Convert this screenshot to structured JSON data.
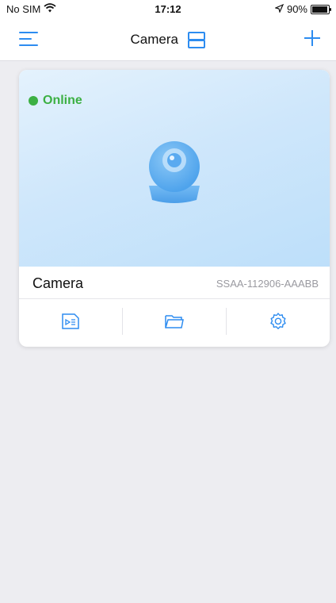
{
  "status_bar": {
    "carrier": "No SIM",
    "time": "17:12",
    "battery": "90%"
  },
  "nav": {
    "title": "Camera"
  },
  "device": {
    "status": "Online",
    "name": "Camera",
    "serial": "SSAA-112906-AAABB"
  },
  "colors": {
    "accent": "#2d8cf0",
    "online": "#3cb043",
    "background": "#ededf1"
  },
  "icons": {
    "menu": "menu-icon",
    "layout": "layout-icon",
    "add": "plus-icon",
    "playback": "video-file-icon",
    "files": "folder-icon",
    "settings": "gear-icon"
  }
}
